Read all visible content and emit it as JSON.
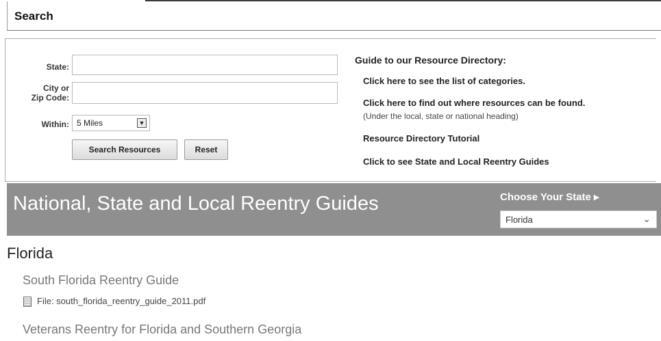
{
  "search": {
    "header": "Search",
    "state_label": "State:",
    "city_label_1": "City or",
    "city_label_2": "Zip Code:",
    "within_label": "Within:",
    "within_value": "5 Miles",
    "search_button": "Search Resources",
    "reset_button": "Reset"
  },
  "guide": {
    "title": "Guide to our Resource Directory:",
    "links": [
      "Click here to see the list of categories.",
      "Click here to find out where resources can be found.",
      "Resource Directory Tutorial",
      "Click to see State and Local Reentry Guides"
    ],
    "note": "(Under the local, state or national heading)"
  },
  "banner": {
    "heading": "National, State and Local Reentry Guides",
    "choose_label": "Choose Your State ▸",
    "selected_state": "Florida"
  },
  "results": {
    "state_heading": "Florida",
    "items": [
      {
        "title": "South Florida Reentry Guide",
        "file": "File: south_florida_reentry_guide_2011.pdf"
      },
      {
        "title": "Veterans Reentry for Florida and Southern Georgia"
      }
    ]
  }
}
